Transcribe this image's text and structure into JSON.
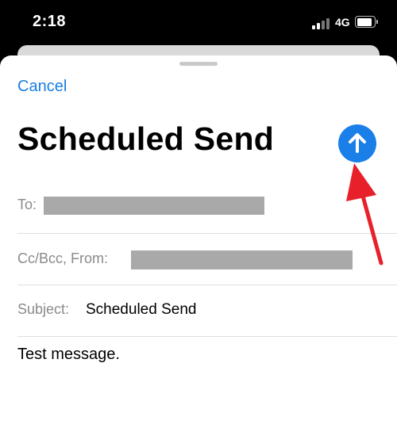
{
  "status_bar": {
    "time": "2:18",
    "network": "4G"
  },
  "compose": {
    "cancel_label": "Cancel",
    "title": "Scheduled Send",
    "to_label": "To:",
    "ccbcc_label": "Cc/Bcc, From:",
    "subject_label": "Subject:",
    "subject_value": "Scheduled Send",
    "body": "Test message."
  },
  "colors": {
    "accent": "#1a7fe8",
    "annotation_arrow": "#e8202a",
    "redaction": "#a9a9a9"
  },
  "icons": [
    "send-arrow-up-icon",
    "signal-icon",
    "battery-icon"
  ]
}
